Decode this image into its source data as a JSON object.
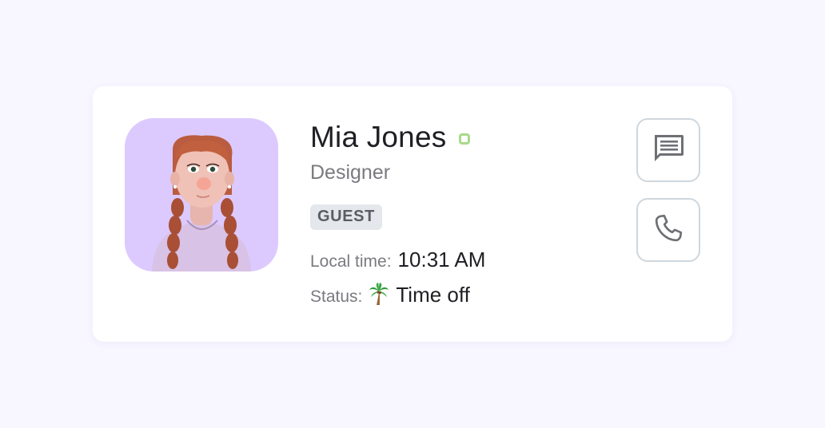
{
  "profile": {
    "name": "Mia Jones",
    "role": "Designer",
    "badge": "GUEST",
    "presence_color": "#a9d98a"
  },
  "details": {
    "local_time_label": "Local time:",
    "local_time_value": "10:31 AM",
    "status_label": "Status:",
    "status_icon": "palm-tree-icon",
    "status_value": "Time off"
  },
  "actions": {
    "message_icon": "message-icon",
    "call_icon": "phone-icon"
  },
  "colors": {
    "background": "#f8f6ff",
    "card": "#ffffff",
    "avatar_bg": "#dccaff",
    "badge_bg": "#e4e7eb",
    "button_border": "#cfd7de"
  }
}
